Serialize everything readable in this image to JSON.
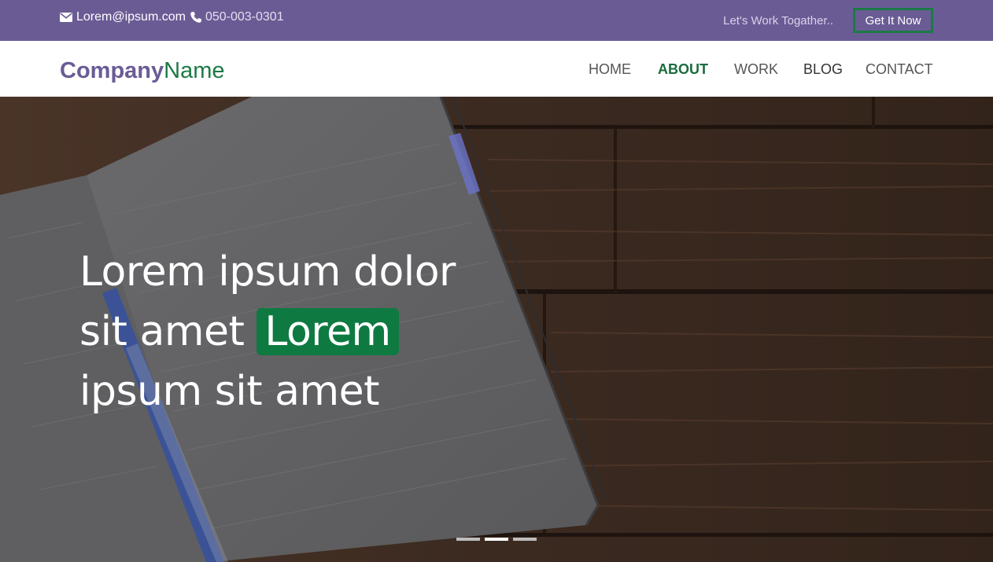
{
  "topbar": {
    "email": "Lorem@ipsum.com",
    "phone": "050-003-0301",
    "tagline": "Let's Work Togather..",
    "cta_label": "Get It Now",
    "background_color": "#6b5b95",
    "cta_border_color": "#1b7a46",
    "icons": [
      "envelope-icon",
      "phone-icon"
    ]
  },
  "navbar": {
    "brand_part1": "Company",
    "brand_part2": "Name",
    "items": [
      {
        "label": "HOME",
        "active": false
      },
      {
        "label": "ABOUT",
        "active": true
      },
      {
        "label": "WORK",
        "active": false
      },
      {
        "label": "BLOG",
        "active": false
      },
      {
        "label": "CONTACT",
        "active": false
      }
    ],
    "accent_color": "#1b7a46",
    "brand_color": "#6b5b95"
  },
  "hero": {
    "headline_line1": "Lorem ipsum dolor",
    "headline_line2_prefix": "sit amet",
    "headline_highlight": "Lorem",
    "headline_line3": "ipsum sit amet",
    "highlight_color": "#0e7a42",
    "slides": {
      "count": 3,
      "active_index": 2
    }
  }
}
